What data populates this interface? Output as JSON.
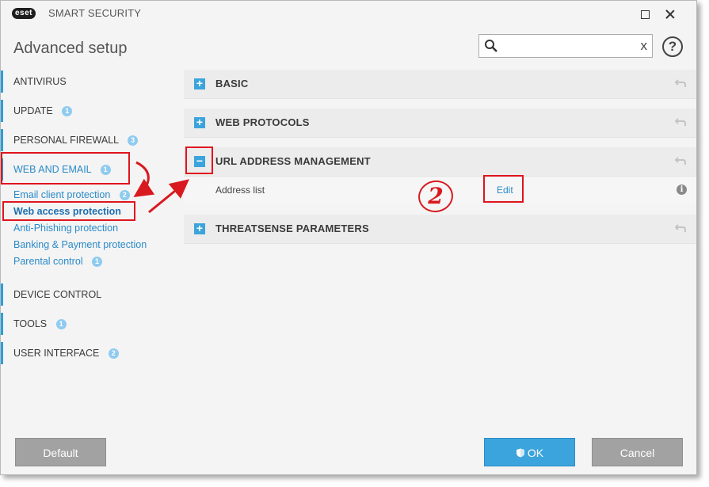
{
  "titlebar": {
    "logo": "eset",
    "product": "SMART SECURITY",
    "minimize_icon": "square-icon",
    "close_icon": "close-icon"
  },
  "header": {
    "title": "Advanced setup",
    "search": {
      "value": "",
      "placeholder": "",
      "clear": "x"
    },
    "help": "?"
  },
  "sidebar": {
    "items": [
      {
        "label": "ANTIVIRUS",
        "badge": ""
      },
      {
        "label": "UPDATE",
        "badge": "1"
      },
      {
        "label": "PERSONAL FIREWALL",
        "badge": "3"
      },
      {
        "label": "WEB AND EMAIL",
        "badge": "1"
      },
      {
        "label": "DEVICE CONTROL",
        "badge": ""
      },
      {
        "label": "TOOLS",
        "badge": "1"
      },
      {
        "label": "USER INTERFACE",
        "badge": "2"
      }
    ],
    "sub_items": [
      {
        "label": "Email client protection",
        "badge": "2"
      },
      {
        "label": "Web access protection",
        "badge": ""
      },
      {
        "label": "Anti-Phishing protection",
        "badge": ""
      },
      {
        "label": "Banking & Payment protection",
        "badge": ""
      },
      {
        "label": "Parental control",
        "badge": "1"
      }
    ]
  },
  "main": {
    "sections": [
      {
        "title": "BASIC",
        "toggle": "+"
      },
      {
        "title": "WEB PROTOCOLS",
        "toggle": "+"
      },
      {
        "title": "URL ADDRESS MANAGEMENT",
        "toggle": "−"
      },
      {
        "title": "THREATSENSE PARAMETERS",
        "toggle": "+"
      }
    ],
    "address_list": {
      "label": "Address list",
      "edit": "Edit",
      "info": "i"
    }
  },
  "annotation": {
    "step": "2"
  },
  "footer": {
    "default": "Default",
    "ok": "OK",
    "cancel": "Cancel"
  },
  "colors": {
    "accent": "#3ba4dc",
    "link": "#2a8ac8",
    "annotation": "#e0141e",
    "button_gray": "#a2a2a2"
  }
}
